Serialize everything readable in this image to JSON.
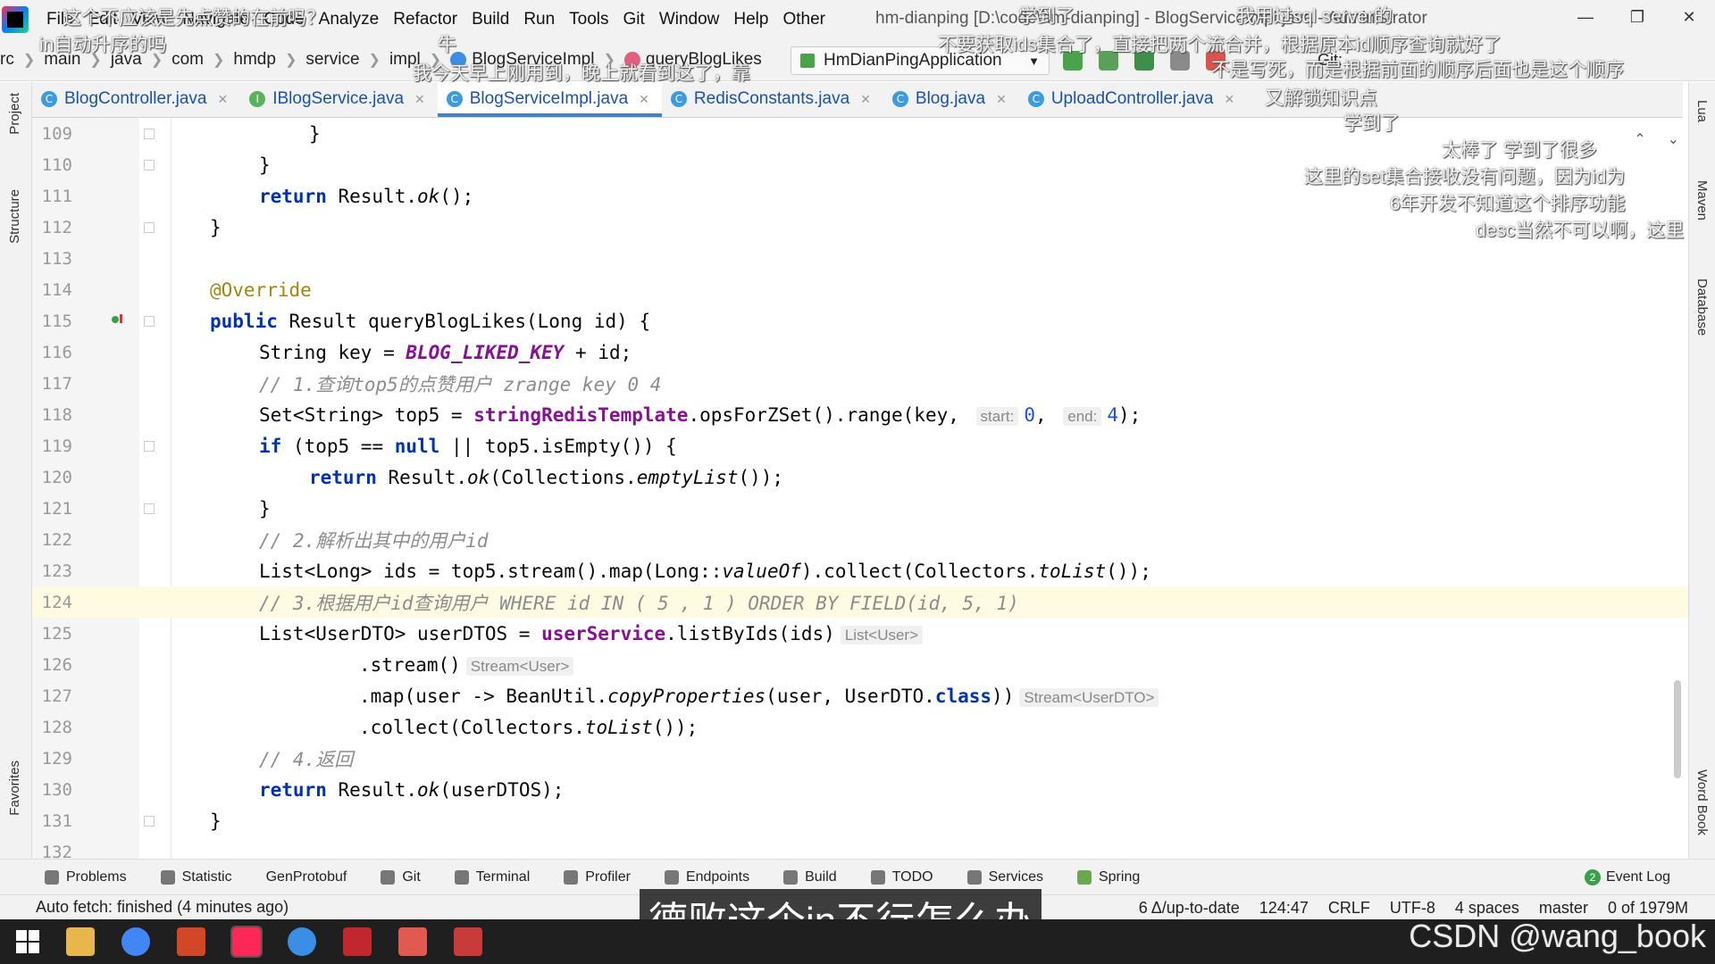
{
  "menu": [
    "File",
    "Edit",
    "View",
    "Navigate",
    "Code",
    "Analyze",
    "Refactor",
    "Build",
    "Run",
    "Tools",
    "Git",
    "Window",
    "Help",
    "Other"
  ],
  "window_title": "hm-dianping [D:\\code\\hm-dianping] - BlogServiceImpl.java - Administrator",
  "breadcrumb": [
    "rc",
    "main",
    "java",
    "com",
    "hmdp",
    "service",
    "impl",
    "BlogServiceImpl",
    "queryBlogLikes"
  ],
  "run_config": "HmDianPingApplication",
  "git_label": "Git:",
  "tabs": [
    {
      "label": "BlogController.java",
      "icon": "C"
    },
    {
      "label": "IBlogService.java",
      "icon": "I"
    },
    {
      "label": "BlogServiceImpl.java",
      "icon": "C"
    },
    {
      "label": "RedisConstants.java",
      "icon": "C"
    },
    {
      "label": "Blog.java",
      "icon": "C"
    },
    {
      "label": "UploadController.java",
      "icon": "C"
    }
  ],
  "left_strip": [
    "Project",
    "Structure",
    "Favorites"
  ],
  "right_strip": [
    "Lua",
    "Maven",
    "Database",
    "Word Book"
  ],
  "line_numbers": [
    "109",
    "110",
    "111",
    "112",
    "113",
    "114",
    "115",
    "116",
    "117",
    "118",
    "119",
    "120",
    "121",
    "122",
    "123",
    "124",
    "125",
    "126",
    "127",
    "128",
    "129",
    "130",
    "131",
    "132"
  ],
  "code": {
    "l109": "}",
    "l110": "}",
    "l111_kw": "return",
    "l111_a": " Result.",
    "l111_it": "ok",
    "l111_b": "();",
    "l112": "}",
    "l114": "@Override",
    "l115_kw": "public",
    "l115_a": " Result queryBlogLikes(Long id) {",
    "l116_a": "String key = ",
    "l116_const": "BLOG_LIKED_KEY",
    "l116_b": " + id;",
    "l117": "// 1.查询top5的点赞用户 zrange key 0 4",
    "l118_a": "Set<String> top5 = ",
    "l118_field": "stringRedisTemplate",
    "l118_b": ".opsForZSet().range(key, ",
    "l118_hint_start": "start:",
    "l118_start": "0",
    "l118_c": ", ",
    "l118_hint_end": "end:",
    "l118_end": "4",
    "l118_d": ");",
    "l119_kw": "if",
    "l119_a": " (top5 == ",
    "l119_null": "null",
    "l119_b": " || top5.isEmpty()) {",
    "l120_kw": "return",
    "l120_a": " Result.",
    "l120_it": "ok",
    "l120_b": "(Collections.",
    "l120_it2": "emptyList",
    "l120_c": "());",
    "l121": "}",
    "l122": "// 2.解析出其中的用户id",
    "l123_a": "List<Long> ids = top5.stream().map(Long::",
    "l123_it": "valueOf",
    "l123_b": ").collect(Collectors.",
    "l123_it2": "toList",
    "l123_c": "());",
    "l124": "// 3.根据用户id查询用户 WHERE id IN ( 5 , 1 ) ORDER BY FIELD(id, 5, 1)",
    "l125_a": "List<UserDTO> userDTOS = ",
    "l125_field": "userService",
    "l125_b": ".listByIds(ids)",
    "l125_hint": "List<User>",
    "l126_a": ".stream()",
    "l126_hint": "Stream<User>",
    "l127_a": ".map(user -> BeanUtil.",
    "l127_it": "copyProperties",
    "l127_b": "(user, UserDTO.",
    "l127_kw": "class",
    "l127_c": "))",
    "l127_hint": "Stream<UserDTO>",
    "l128_a": ".collect(Collectors.",
    "l128_it": "toList",
    "l128_b": "());",
    "l129": "// 4.返回",
    "l130_kw": "return",
    "l130_a": " Result.",
    "l130_it": "ok",
    "l130_b": "(userDTOS);",
    "l131": "}"
  },
  "danmaku": [
    "这个不应该是先点赞的在前吗？",
    "in自动升序的吗",
    "学到了",
    "我用过sql server的",
    "牛",
    "不要获取ids集合了，直接把两个流合并，根据原本id顺序查询就好了",
    "我今天早上刚用到，晚上就看到这了，靠",
    "不是写死，而是根据前面的顺序后面也是这个顺序",
    "又解锁知识点",
    "学到了",
    "太棒了  学到了很多",
    "这里的set集合接收没有问题，因为id为",
    "6年开发不知道这个排序功能",
    "desc当然不可以啊，这里"
  ],
  "bottom_tools": [
    "Problems",
    "Statistic",
    "GenProtobuf",
    "Git",
    "Terminal",
    "Profiler",
    "Endpoints",
    "Build",
    "TODO",
    "Services",
    "Spring"
  ],
  "event_log": {
    "count": "2",
    "label": "Event Log"
  },
  "status": {
    "message": "Auto fetch: finished (4 minutes ago)",
    "vcs": "6 Δ/up-to-date",
    "position": "124:47",
    "line_sep": "CRLF",
    "encoding": "UTF-8",
    "indent": "4 spaces",
    "branch": "master",
    "memory": "0 of 1979M"
  },
  "subtitle": "德败这个in不行怎么办",
  "watermark": "CSDN @wang_book"
}
